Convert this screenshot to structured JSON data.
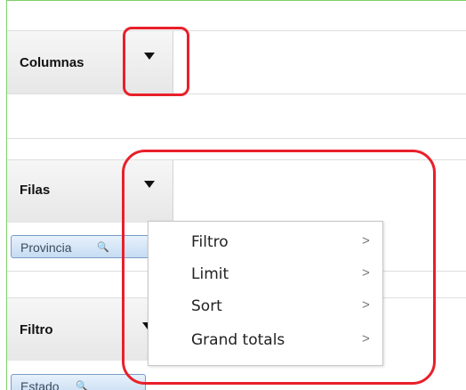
{
  "sections": {
    "columns": {
      "label": "Columnas"
    },
    "rows": {
      "label": "Filas",
      "pill": "Provincia"
    },
    "filter": {
      "label": "Filtro",
      "pill": "Estado"
    }
  },
  "menu": {
    "items": [
      {
        "label": "Filtro",
        "submenu_arrow": ">"
      },
      {
        "label": "Limit",
        "submenu_arrow": ">"
      },
      {
        "label": "Sort",
        "submenu_arrow": ">"
      },
      {
        "label": "Grand totals",
        "submenu_arrow": ">"
      }
    ]
  },
  "colors": {
    "annotation": "#e8202a",
    "frame_border": "#7fd06a",
    "pill_border": "#7a9cc6"
  },
  "icons": [
    "dropdown-arrow-icon",
    "magnifier-icon",
    "submenu-arrow-icon"
  ]
}
